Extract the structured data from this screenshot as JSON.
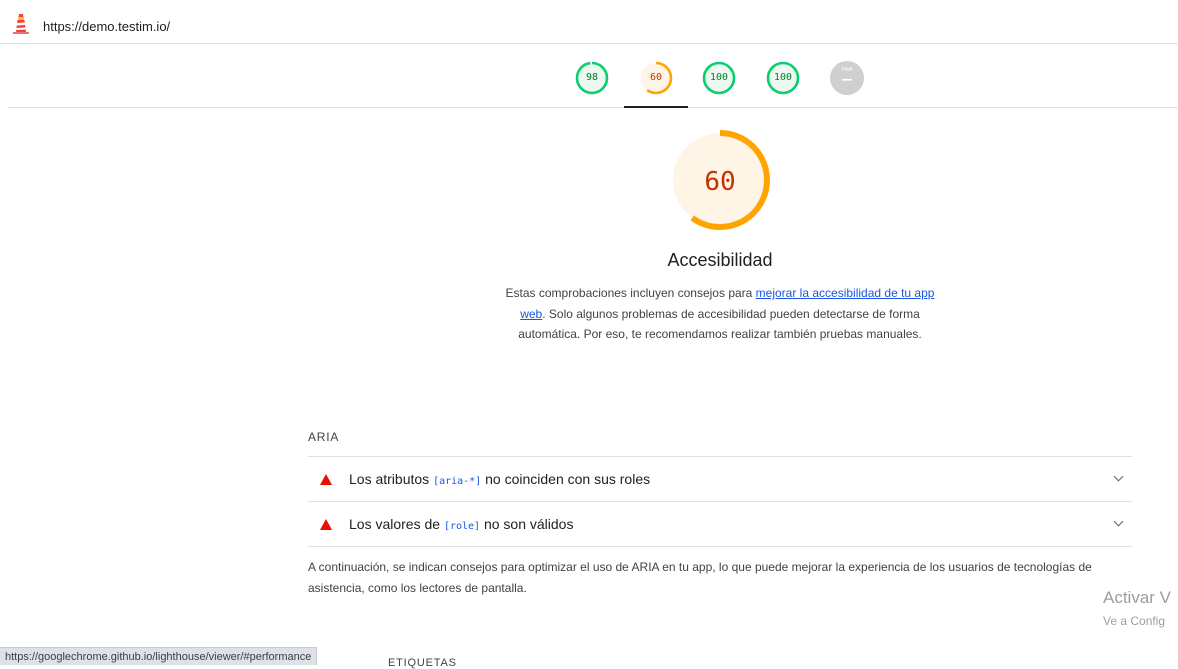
{
  "header": {
    "url": "https://demo.testim.io/"
  },
  "gauges": [
    {
      "label": "98",
      "score": 0.98,
      "status": "pass",
      "color": "#0cce6b"
    },
    {
      "label": "60",
      "score": 0.6,
      "status": "average",
      "color": "#ffa400",
      "active": true
    },
    {
      "label": "100",
      "score": 1.0,
      "status": "pass",
      "color": "#0cce6b"
    },
    {
      "label": "100",
      "score": 1.0,
      "status": "pass",
      "color": "#0cce6b"
    },
    {
      "label": "PWA",
      "status": "na",
      "color": "#c8c8c8"
    }
  ],
  "category": {
    "score_label": "60",
    "score": 0.6,
    "title": "Accesibilidad",
    "desc_before": "Estas comprobaciones incluyen consejos para ",
    "desc_link": "mejorar la accesibilidad de tu app web",
    "desc_after": ". Solo algunos problemas de accesibilidad pueden detectarse de forma automática. Por eso, te recomendamos realizar también pruebas manuales."
  },
  "group": {
    "title": "ARIA",
    "audits": [
      {
        "before": "Los atributos ",
        "code": "[aria-*]",
        "after": " no coinciden con sus roles"
      },
      {
        "before": "Los valores de ",
        "code": "[role]",
        "after": " no son válidos"
      }
    ],
    "description": "A continuación, se indican consejos para optimizar el uso de ARIA en tu app, lo que puede mejorar la experiencia de los usuarios de tecnologías de asistencia, como los lectores de pantalla."
  },
  "overlay": {
    "watermark_title": "Activar V",
    "watermark_sub": "Ve a Config",
    "status_url": "https://googlechrome.github.io/lighthouse/viewer/#performance",
    "peek_text": "ETIQUETAS"
  },
  "colors": {
    "pass": "#0cce6b",
    "average": "#ffa400",
    "fail": "#eb0f00",
    "link": "#1a55e5"
  }
}
